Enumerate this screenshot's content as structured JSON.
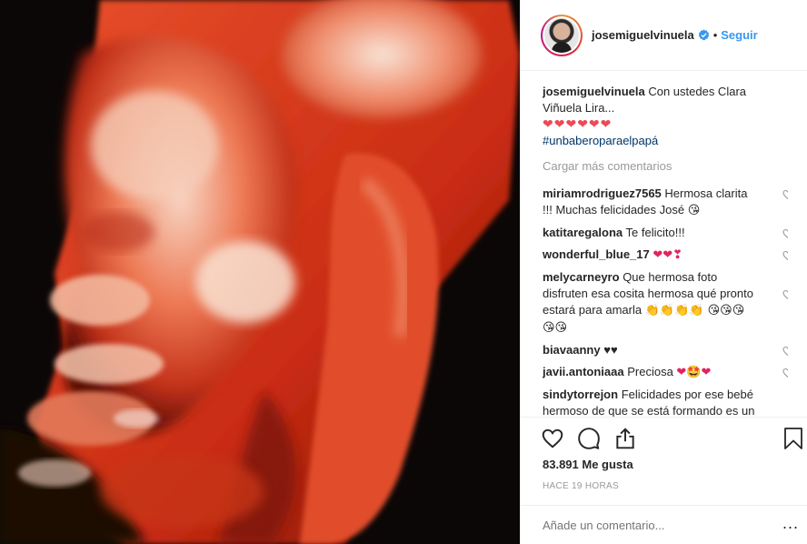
{
  "post": {
    "username": "josemiguelvinuela",
    "follow_label": "Seguir",
    "dot": "•"
  },
  "caption": {
    "username": "josemiguelvinuela",
    "text": "Con ustedes Clara Viñuela Lira...",
    "hearts": "❤❤❤❤❤❤",
    "hashtag": "#unbaberoparaelpapá"
  },
  "load_more": "Cargar más comentarios",
  "comments": [
    {
      "user": "miriamrodriguez7565",
      "text": "Hermosa clarita !!! Muchas felicidades José",
      "emoji": "😘"
    },
    {
      "user": "katitaregalona",
      "text": "Te felicito!!!",
      "emoji": ""
    },
    {
      "user": "wonderful_blue_17",
      "text": "",
      "emoji": "❤❤❣"
    },
    {
      "user": "melycarneyro",
      "text": "Que hermosa foto disfruten esa cosita hermosa qué pronto estará para amarla",
      "emoji": "👏👏👏👏 😘😘😘😘😘"
    },
    {
      "user": "biavaanny",
      "text": "♥♥",
      "emoji": ""
    },
    {
      "user": "javii.antoniaaa",
      "text": "Preciosa",
      "emoji": "❤🤩❤"
    },
    {
      "user": "sindytorrejon",
      "text": "Felicidades por ese bebé hermoso de que se está formando es un hermoso angelito iba a llegar a",
      "emoji": ""
    }
  ],
  "likes": "83.891 Me gusta",
  "time": "HACE 19 HORAS",
  "add_comment_placeholder": "Añade un comentario...",
  "more_options": "...",
  "icons": {
    "like": "heart-outline-icon",
    "comment": "speech-bubble-icon",
    "share": "share-upload-icon",
    "save": "bookmark-icon",
    "verified": "verified-badge-icon"
  },
  "colors": {
    "link": "#3897f0",
    "hashtag": "#003569",
    "muted": "#999999",
    "heart": "#ed4956"
  }
}
